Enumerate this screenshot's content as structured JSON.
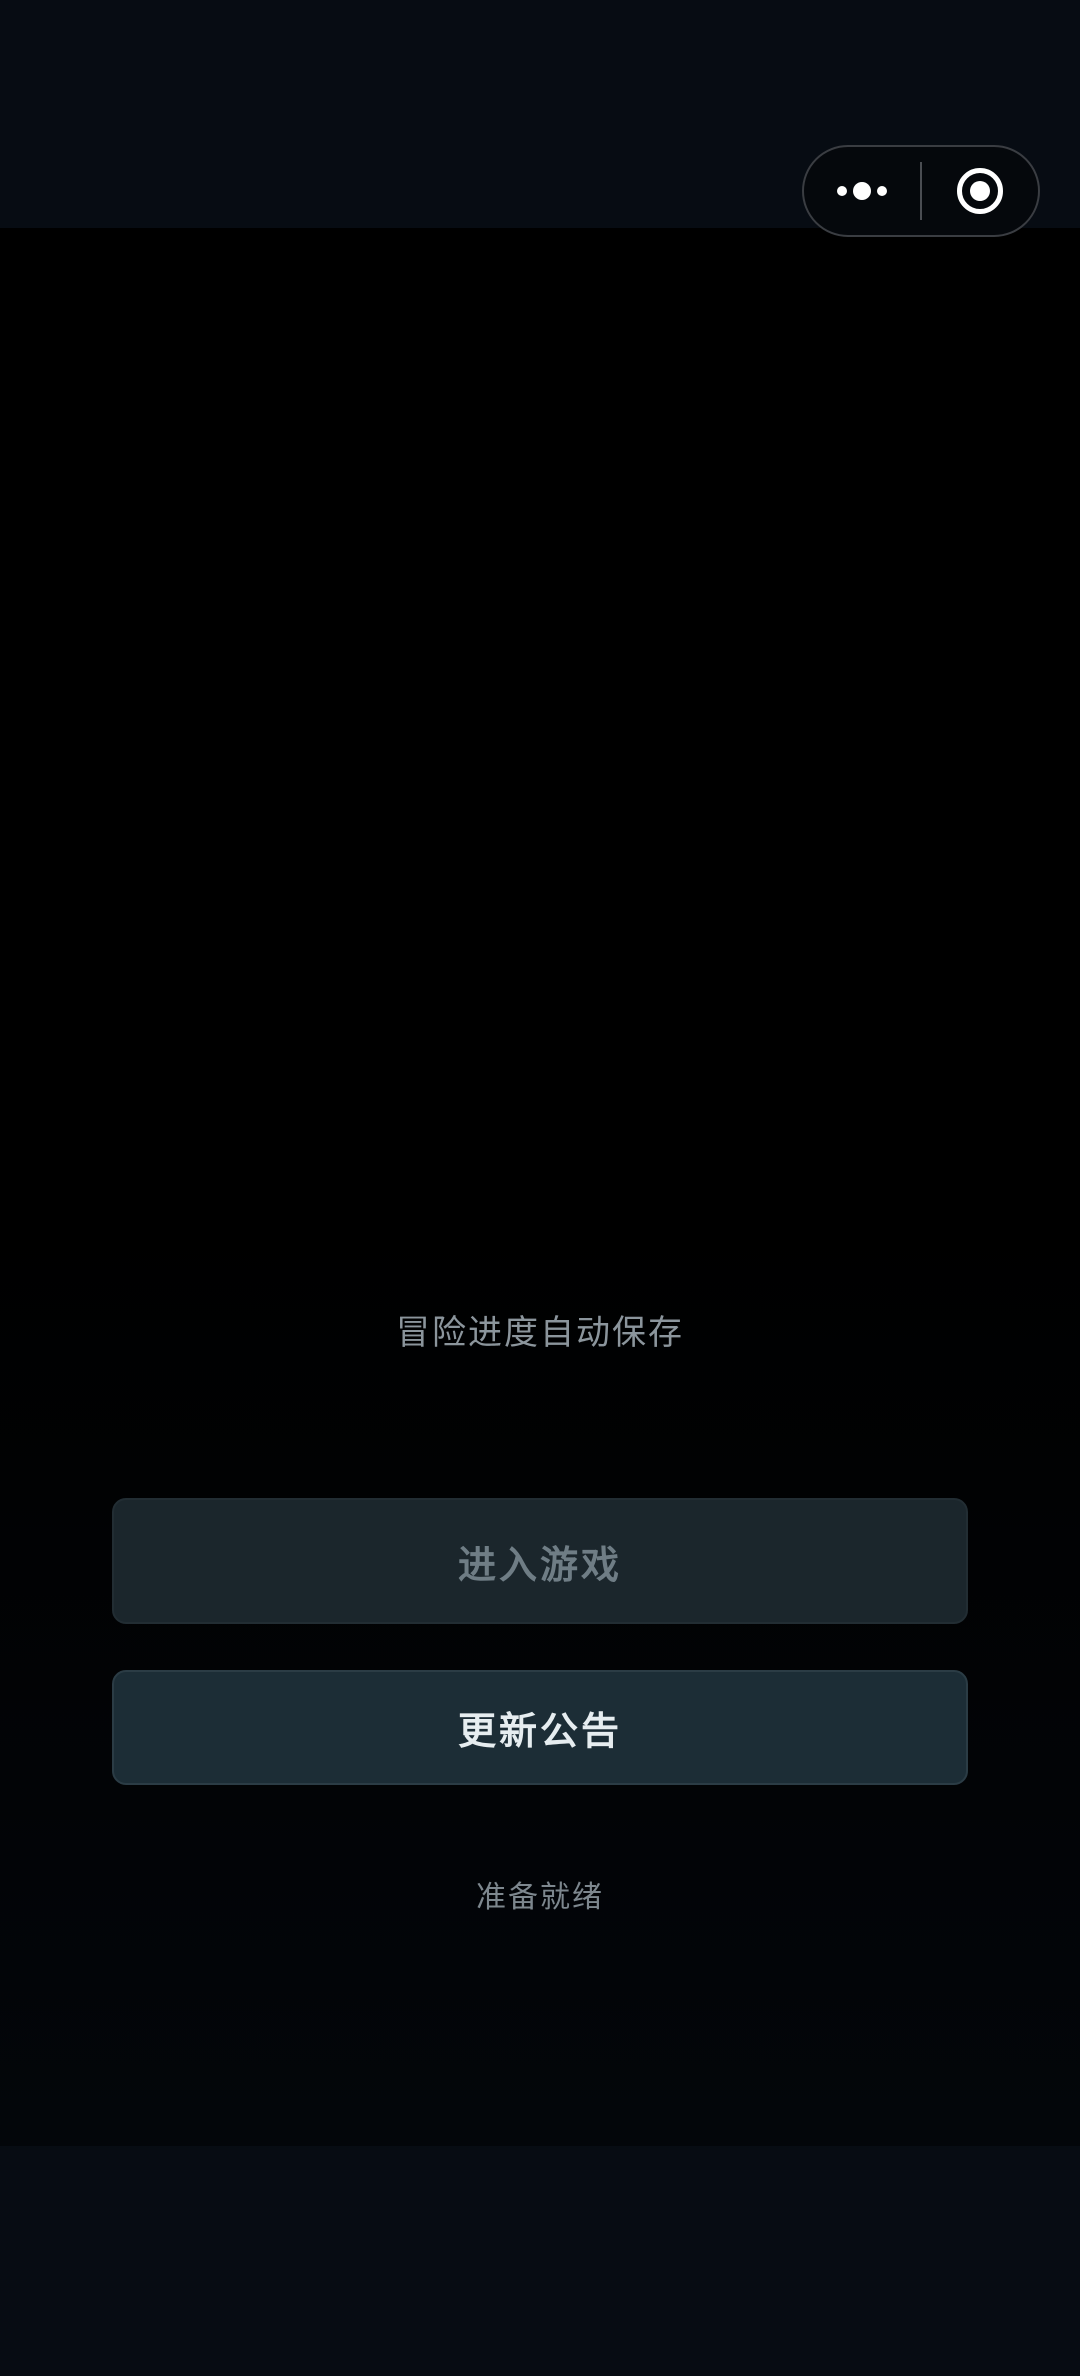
{
  "top_bar": {
    "capsule": {
      "more_icon": "more-dots-icon",
      "close_icon": "target-close-icon"
    }
  },
  "main": {
    "hint_text": "冒险进度自动保存",
    "enter_button_label": "进入游戏",
    "notice_button_label": "更新公告",
    "status_text": "准备就绪"
  },
  "colors": {
    "background": "#000000",
    "bar": "#070c13",
    "button_enter_bg": "#1b262c",
    "button_notice_bg": "#1c2d36"
  }
}
